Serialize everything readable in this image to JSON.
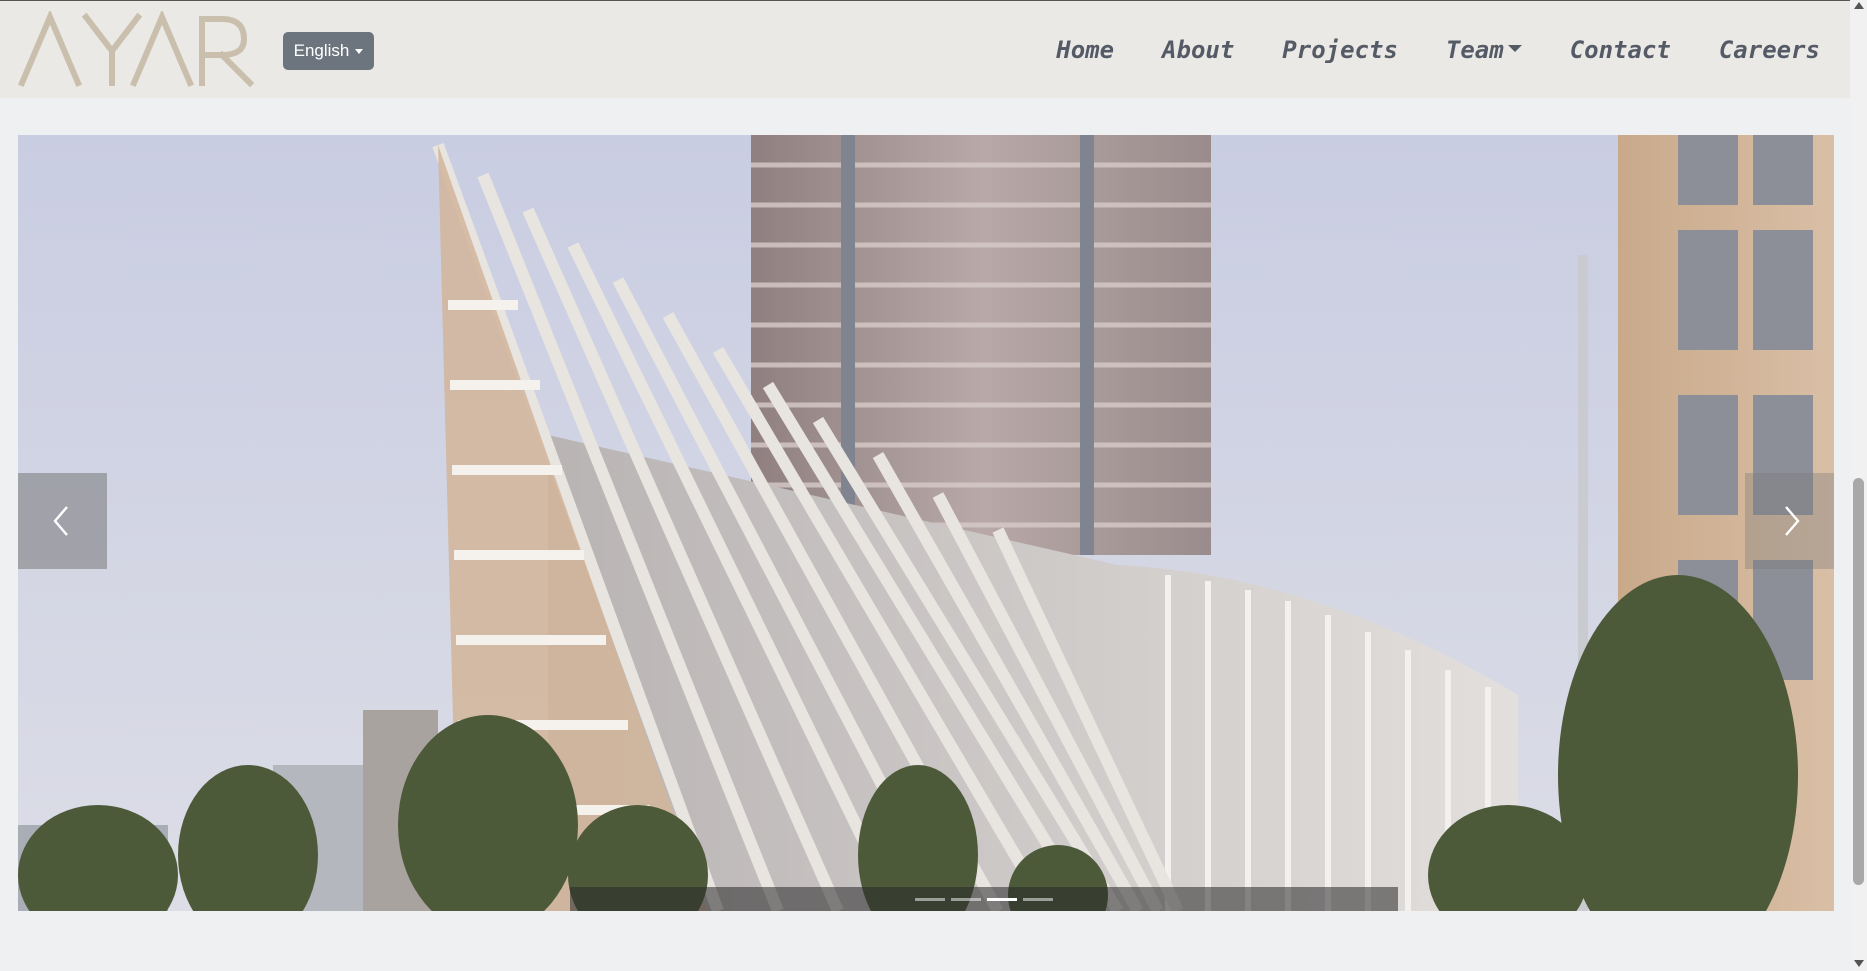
{
  "brand": {
    "logo_text": "AYAR"
  },
  "language": {
    "selected": "English"
  },
  "nav": {
    "home": "Home",
    "about": "About",
    "projects": "Projects",
    "team": "Team",
    "contact": "Contact",
    "careers": "Careers"
  },
  "carousel": {
    "slide_count": 4,
    "active_index": 2
  },
  "colors": {
    "navbar_bg": "#ebe9e5",
    "nav_link": "#555b66",
    "lang_button": "#6c757d",
    "logo": "#c9bfac"
  }
}
